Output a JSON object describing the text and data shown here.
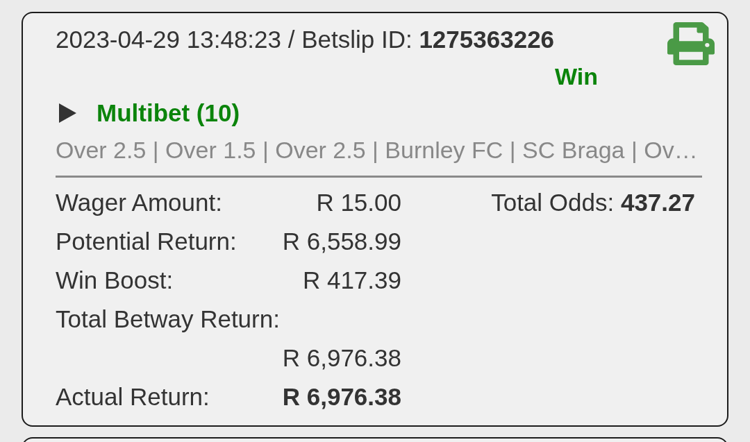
{
  "betslip": {
    "header": "2023-04-29 13:48:23 / Betslip ID: **1275363226**",
    "status": "Win",
    "bet_type": {
      "label": "Multibet (10)",
      "expanded": false
    },
    "selections": "Over 2.5 | Over 1.5 | Over 2.5 | Burnley FC | SC Braga | Ov…",
    "amounts": [
      {
        "label": "Wager Amount:",
        "value": "R 15.00",
        "bold": false
      },
      {
        "label": "Potential Return:",
        "value": "R 6,558.99",
        "bold": false
      },
      {
        "label": "Win Boost:",
        "value": "R 417.39",
        "bold": false
      },
      {
        "label": "Total Betway Return:",
        "value": "R 6,976.38",
        "bold": false
      },
      {
        "label": "Actual Return:",
        "value": "R 6,976.38",
        "bold": true
      }
    ],
    "total_odds": "Total Odds: **437.27**"
  }
}
